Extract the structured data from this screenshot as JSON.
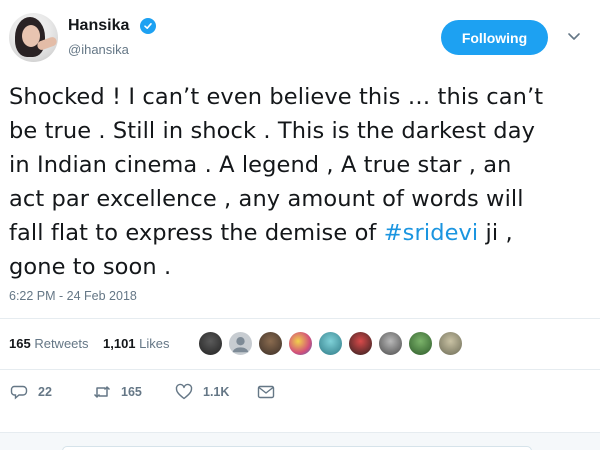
{
  "user": {
    "display_name": "Hansika",
    "handle": "@ihansika",
    "verified": true,
    "follow_label": "Following"
  },
  "tweet": {
    "lines": [
      "Shocked ! I can’t even believe this … this can’t",
      "be true . Still in shock . This is the darkest day",
      "in Indian cinema . A legend , A true star , an",
      "act par excellence , any amount of words will",
      "fall flat to express the demise of ",
      "gone to soon ."
    ],
    "hashtag": "#sridevi",
    "after_hashtag": " ji  ,",
    "timestamp": "6:22 PM - 24 Feb 2018"
  },
  "stats": {
    "retweets_count": "165",
    "retweets_label": "Retweets",
    "likes_count": "1,101",
    "likes_label": "Likes"
  },
  "actions": {
    "reply_count": "22",
    "retweet_count": "165",
    "like_count": "1.1K"
  },
  "colors": {
    "accent": "#1da1f2",
    "hashtag": "#1b95e0",
    "muted": "#657786"
  },
  "icons": [
    "verified-badge-icon",
    "chevron-down-icon",
    "reply-icon",
    "retweet-icon",
    "like-icon",
    "direct-message-icon"
  ]
}
